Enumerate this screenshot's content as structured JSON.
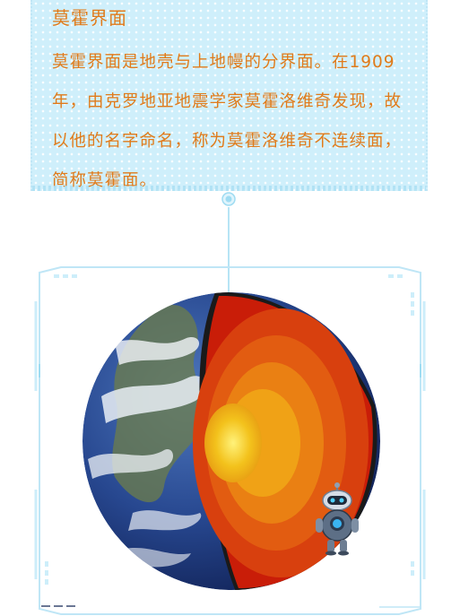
{
  "card": {
    "title": "莫霍界面",
    "body": "莫霍界面是地壳与上地幔的分界面。在1909年，由克罗地亚地震学家莫霍洛维奇发现，故以他的名字命名，称为莫霍洛维奇不连续面，简称莫霍面。"
  },
  "colors": {
    "text": "#e07b1a",
    "card_bg": "#cfeffb",
    "frame": "#b6e4f5",
    "ocean": "#1e3b7a",
    "mantle": "#d83a10",
    "core": "#f5c420"
  },
  "icons": {
    "connector": "connector-dot-icon",
    "robot": "robot-mascot-icon"
  }
}
